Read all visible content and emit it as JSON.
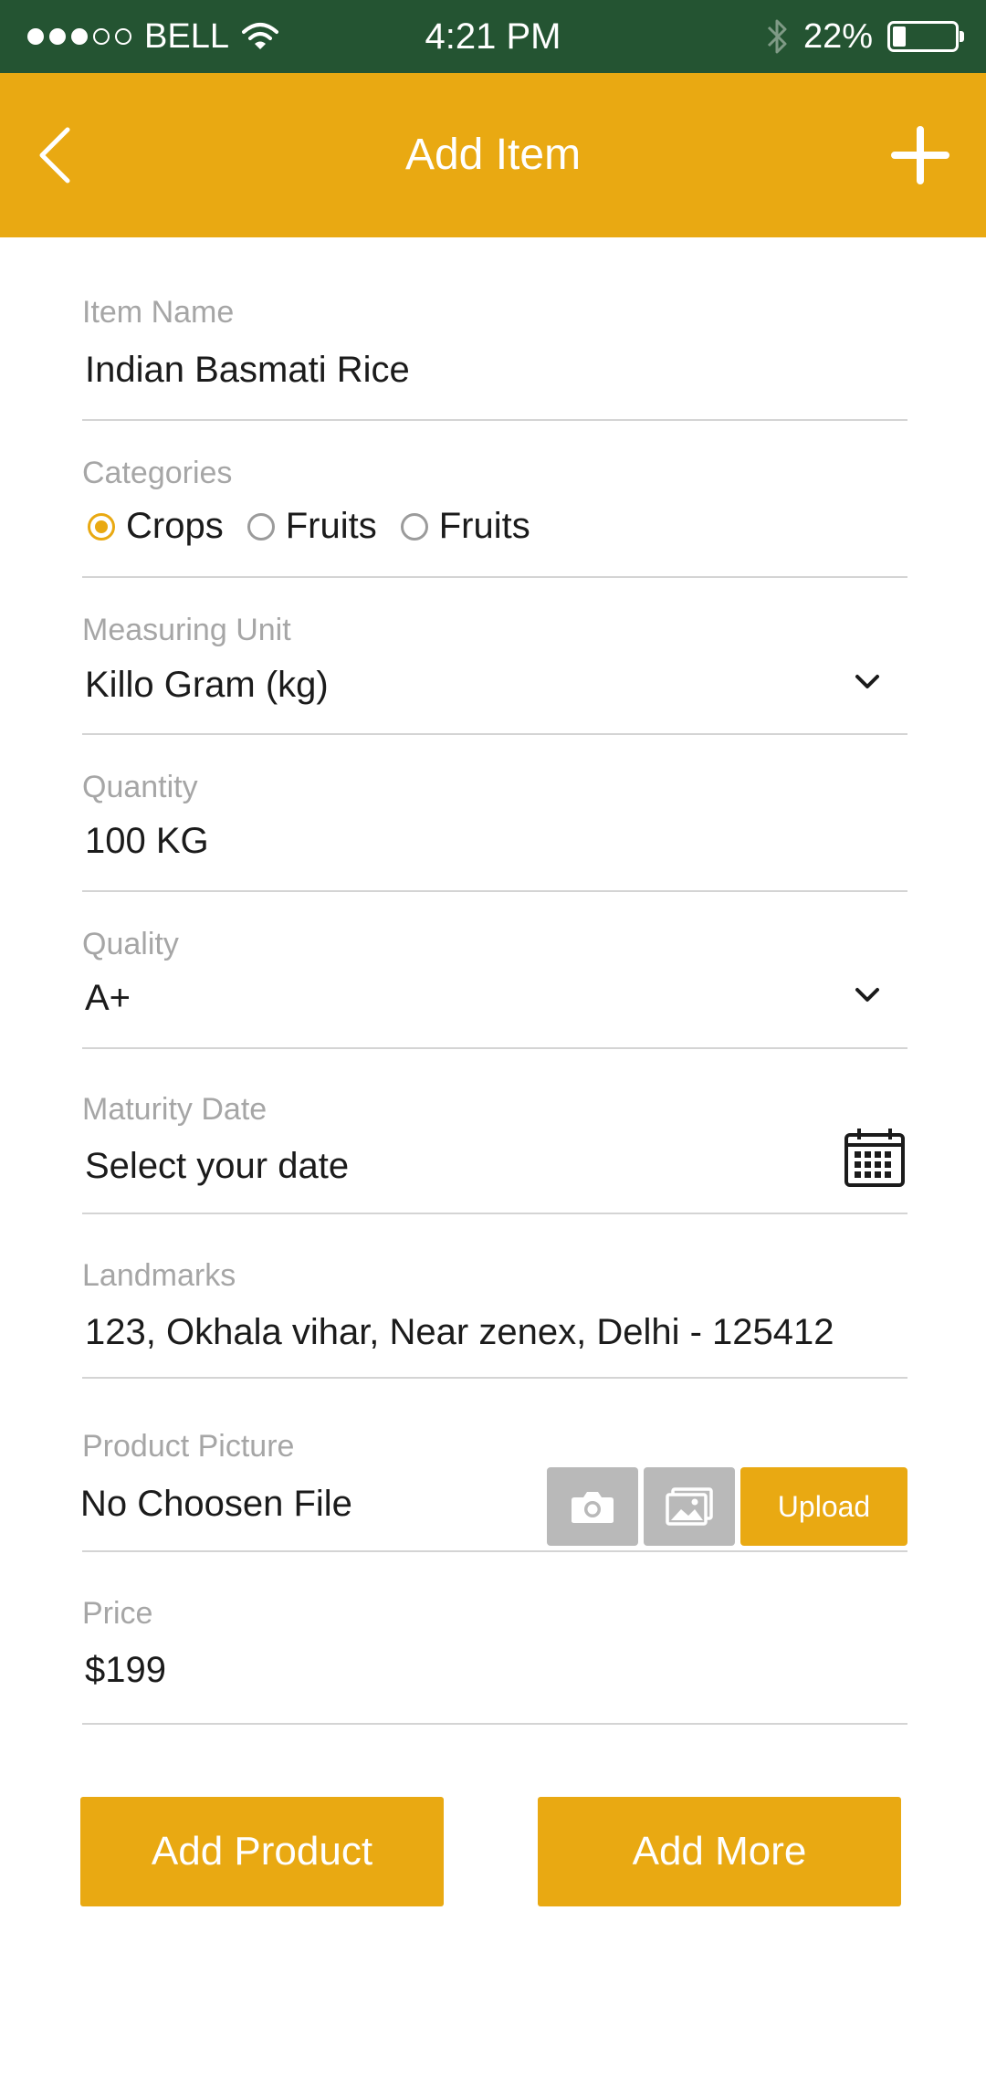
{
  "status_bar": {
    "carrier": "BELL",
    "time": "4:21 PM",
    "battery": "22%",
    "battery_level": 0.22,
    "icons": [
      "signal-dots",
      "wifi-icon",
      "bluetooth-icon",
      "battery-icon"
    ]
  },
  "header": {
    "title": "Add Item",
    "back_icon": "chevron-left-icon",
    "add_icon": "plus-icon"
  },
  "form": {
    "item_name": {
      "label": "Item Name",
      "value": "Indian Basmati Rice"
    },
    "categories": {
      "label": "Categories",
      "options": [
        "Crops",
        "Fruits",
        "Fruits"
      ],
      "selected_index": 0
    },
    "measuring_unit": {
      "label": "Measuring Unit",
      "value": "Killo Gram (kg)"
    },
    "quantity": {
      "label": "Quantity",
      "value": "100 KG"
    },
    "quality": {
      "label": "Quality",
      "value": "A+"
    },
    "maturity_date": {
      "label": "Maturity Date",
      "placeholder": "Select your date"
    },
    "landmarks": {
      "label": "Landmarks",
      "value": "123, Okhala vihar, Near zenex, Delhi - 125412"
    },
    "product_picture": {
      "label": "Product Picture",
      "value": "No Choosen File",
      "upload_label": "Upload",
      "camera_icon": "camera-icon",
      "gallery_icon": "gallery-icon"
    },
    "price": {
      "label": "Price",
      "value": "$199"
    }
  },
  "actions": {
    "add_product": "Add Product",
    "add_more": "Add More"
  },
  "colors": {
    "status_bar_bg": "#245432",
    "accent": "#E9A912",
    "label_gray": "#a6a6a6",
    "divider": "#d4d4d4",
    "icon_button_gray": "#b9b9b9"
  }
}
